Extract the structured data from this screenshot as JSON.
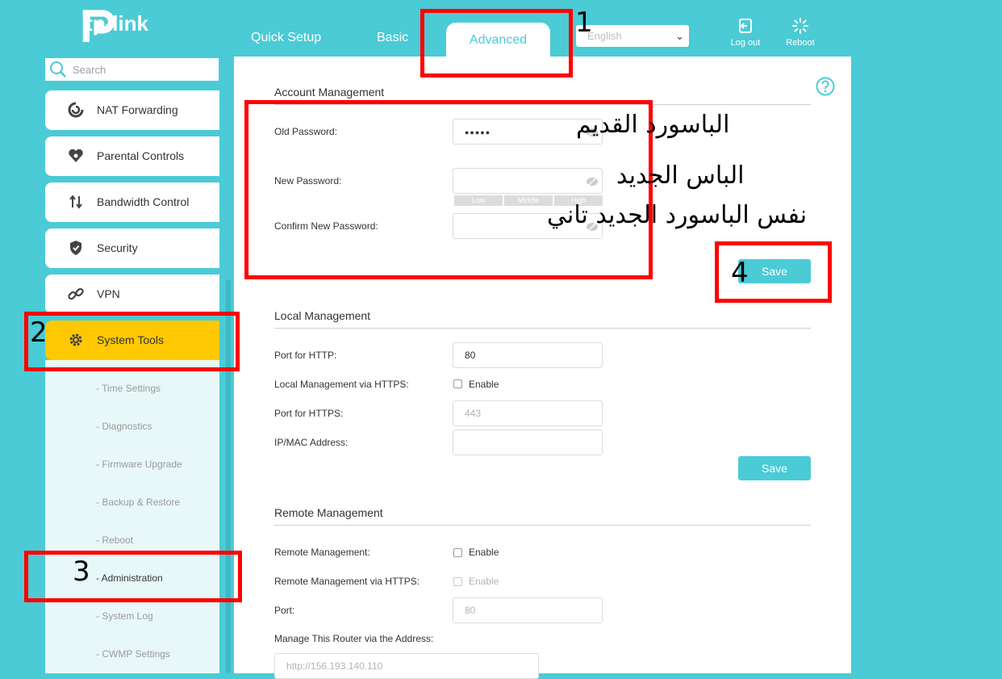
{
  "header": {
    "logo_text": "tp-link",
    "tabs": [
      {
        "label": "Quick Setup"
      },
      {
        "label": "Basic"
      },
      {
        "label": "Advanced"
      }
    ],
    "language": "English",
    "logout_label": "Log out",
    "reboot_label": "Reboot"
  },
  "sidebar": {
    "search_placeholder": "Search",
    "items": [
      {
        "label": "NAT Forwarding",
        "icon": "nat-forwarding-icon"
      },
      {
        "label": "Parental Controls",
        "icon": "parental-controls-icon"
      },
      {
        "label": "Bandwidth Control",
        "icon": "bandwidth-control-icon"
      },
      {
        "label": "Security",
        "icon": "shield-icon"
      },
      {
        "label": "VPN",
        "icon": "vpn-link-icon"
      },
      {
        "label": "System Tools",
        "icon": "gear-icon"
      }
    ],
    "subitems": [
      {
        "label": "- Time Settings"
      },
      {
        "label": "- Diagnostics"
      },
      {
        "label": "- Firmware Upgrade"
      },
      {
        "label": "- Backup & Restore"
      },
      {
        "label": "- Reboot"
      },
      {
        "label": "- Administration"
      },
      {
        "label": "- System Log"
      },
      {
        "label": "- CWMP Settings"
      }
    ]
  },
  "account": {
    "title": "Account Management",
    "old_label": "Old Password:",
    "old_value": "●●●●●",
    "new_label": "New Password:",
    "strength": [
      "Low",
      "Middle",
      "High"
    ],
    "confirm_label": "Confirm New Password:",
    "save": "Save"
  },
  "local": {
    "title": "Local Management",
    "http_label": "Port for HTTP:",
    "http_value": "80",
    "https_mgmt_label": "Local Management via HTTPS:",
    "enable": "Enable",
    "https_port_label": "Port for HTTPS:",
    "https_port_value": "443",
    "ipmac_label": "IP/MAC Address:",
    "save": "Save"
  },
  "remote": {
    "title": "Remote Management",
    "remote_label": "Remote Management:",
    "enable": "Enable",
    "remote_https_label": "Remote Management via HTTPS:",
    "enable_dim": "Enable",
    "port_label": "Port:",
    "port_value": "80",
    "address_label": "Manage This Router via the Address:",
    "address_value": "http://156.193.140.110"
  },
  "annotations": {
    "n1": "1",
    "n2": "2",
    "n3": "3",
    "n4": "4",
    "ar_old": "الباسورد القديم",
    "ar_new": "الباس الجديد",
    "ar_confirm": "نفس الباسورد الجديد تاني"
  },
  "colors": {
    "brand": "#4acbd6",
    "active_menu": "#ffc800",
    "annotation_red": "#ff0000"
  }
}
